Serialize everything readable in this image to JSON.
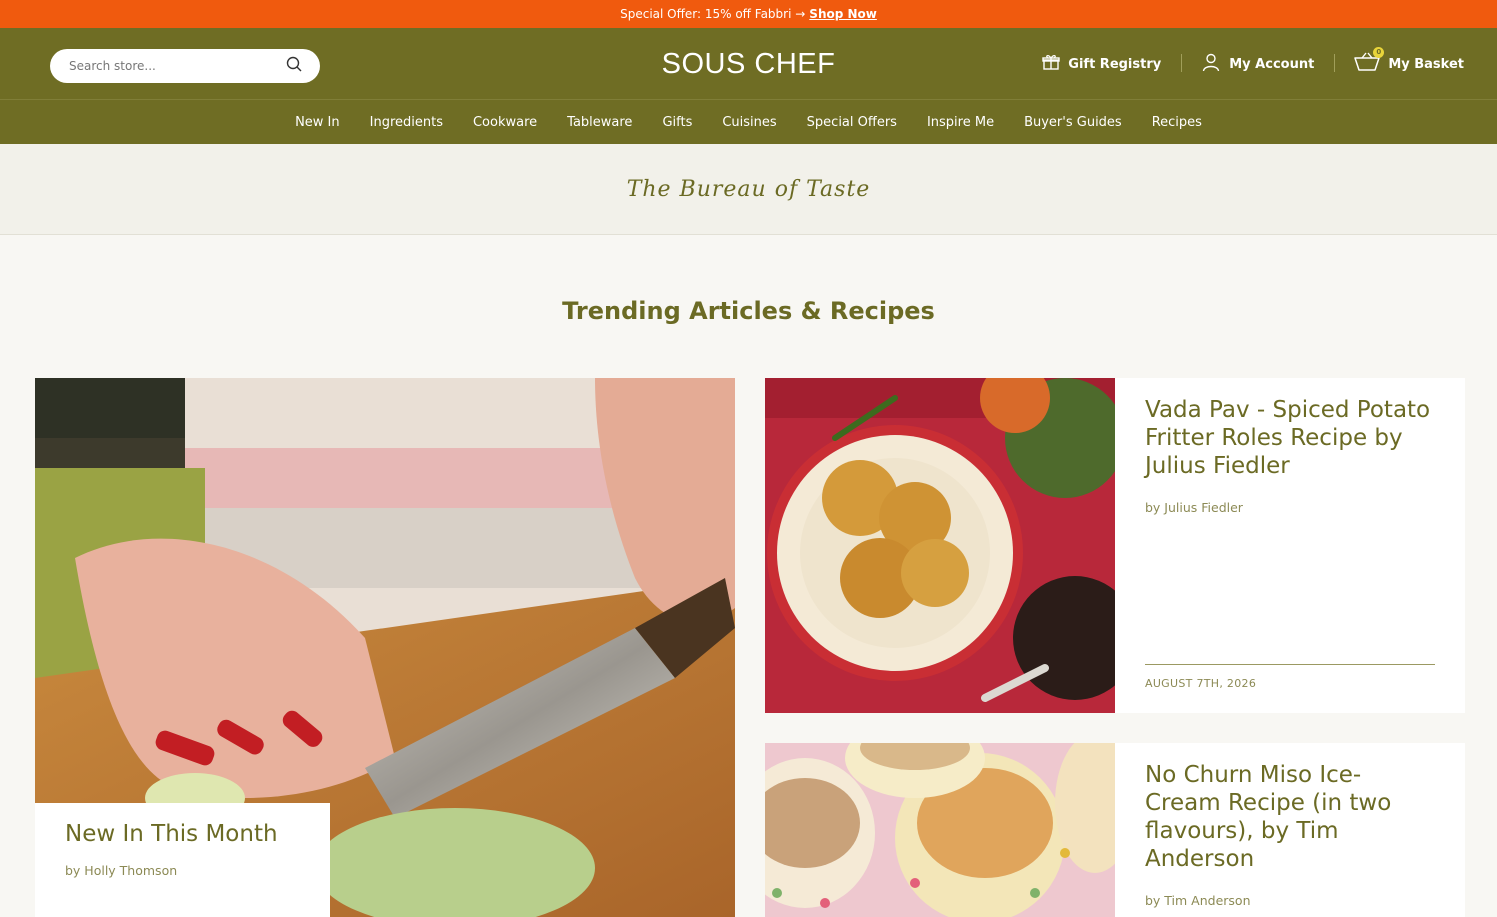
{
  "promo": {
    "text": "Special Offer: 15% off Fabbri →",
    "link": "Shop Now"
  },
  "header": {
    "search_placeholder": "Search store...",
    "logo": "SOUS CHEF",
    "gift_registry": "Gift Registry",
    "my_account": "My Account",
    "my_basket": "My Basket",
    "basket_count": "0"
  },
  "nav": [
    "New In",
    "Ingredients",
    "Cookware",
    "Tableware",
    "Gifts",
    "Cuisines",
    "Special Offers",
    "Inspire Me",
    "Buyer's Guides",
    "Recipes"
  ],
  "bureau": "The Bureau of Taste",
  "section_title": "Trending Articles & Recipes",
  "featured": {
    "title": "New In This Month",
    "author": "by Holly Thomson"
  },
  "articles": [
    {
      "title": "Vada Pav - Spiced Potato Fritter Roles Recipe by Julius Fiedler",
      "author": "by Julius Fiedler",
      "date": "AUGUST 7TH, 2026"
    },
    {
      "title": "No Churn Miso Ice-Cream Recipe (in two flavours), by Tim Anderson",
      "author": "by Tim Anderson"
    }
  ],
  "colors": {
    "promo": "#f05a0e",
    "brand_olive": "#6f6d24",
    "page_bg": "#f8f7f3"
  }
}
